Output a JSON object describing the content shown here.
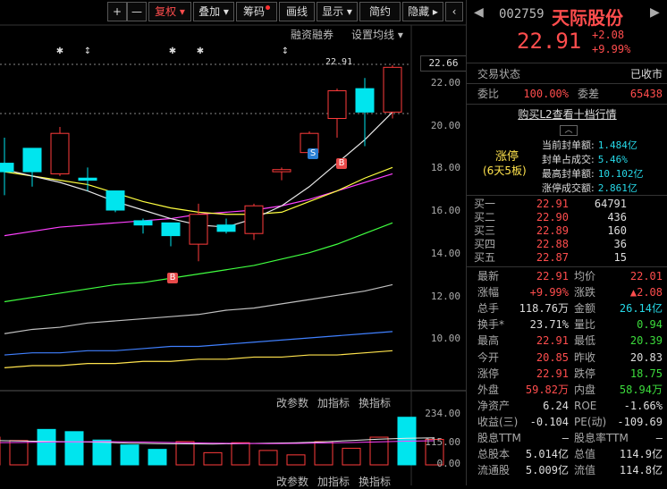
{
  "toolbar": {
    "plus": "+",
    "minus": "—",
    "fuquan": "复权",
    "diejia": "叠加",
    "chouma": "筹码",
    "huaxian": "画线",
    "xianshi": "显示",
    "jianyue": "简约",
    "yincang": "隐藏"
  },
  "chart_sub": {
    "rongzi": "融资融券",
    "shezhi": "设置均线"
  },
  "price_marker": "22.91",
  "current_price_tag": "22.66",
  "y_ticks": [
    "22.00",
    "20.00",
    "18.00",
    "16.00",
    "14.00",
    "12.00",
    "10.00"
  ],
  "signal_s": "S",
  "signal_b": "B",
  "indicator": {
    "gaicanshu": "改参数",
    "jiazhibiao": "加指标",
    "huanzhibiao": "换指标"
  },
  "vol_ticks": [
    "234.00",
    "115.00",
    "0.00"
  ],
  "chart_data": {
    "type": "candlestick",
    "ylim": [
      9,
      23
    ],
    "candles": [
      {
        "o": 18.2,
        "c": 17.8,
        "h": 19.4,
        "l": 16.7
      },
      {
        "o": 18.9,
        "c": 17.8,
        "h": 18.9,
        "l": 17.1
      },
      {
        "o": 17.7,
        "c": 19.6,
        "h": 19.9,
        "l": 17.6
      },
      {
        "o": 17.5,
        "c": 17.4,
        "h": 18.0,
        "l": 16.9
      },
      {
        "o": 16.9,
        "c": 16.0,
        "h": 16.9,
        "l": 15.9
      },
      {
        "o": 15.5,
        "c": 15.3,
        "h": 15.6,
        "l": 14.9
      },
      {
        "o": 15.4,
        "c": 14.8,
        "h": 15.3,
        "l": 14.3
      },
      {
        "o": 14.4,
        "c": 15.8,
        "h": 16.3,
        "l": 13.6
      },
      {
        "o": 15.3,
        "c": 15.0,
        "h": 15.6,
        "l": 14.9
      },
      {
        "o": 14.9,
        "c": 16.2,
        "h": 16.3,
        "l": 14.6
      },
      {
        "o": 17.8,
        "c": 17.9,
        "h": 18.0,
        "l": 17.4
      },
      {
        "o": 18.7,
        "c": 19.6,
        "h": 19.7,
        "l": 18.6
      },
      {
        "o": 20.3,
        "c": 21.6,
        "h": 21.7,
        "l": 19.4
      },
      {
        "o": 21.7,
        "c": 20.6,
        "h": 22.2,
        "l": 19.0
      },
      {
        "o": 20.6,
        "c": 22.7,
        "h": 22.8,
        "l": 20.3
      }
    ],
    "ma5": [
      17.9,
      17.6,
      17.3,
      16.9,
      16.4,
      16.0,
      15.6,
      15.3,
      15.2,
      15.6,
      16.2,
      17.1,
      18.2,
      19.3,
      20.6
    ],
    "ma10": [
      17.8,
      17.6,
      17.4,
      17.2,
      16.8,
      16.4,
      16.1,
      15.9,
      15.8,
      15.8,
      15.9,
      16.4,
      16.9,
      17.5,
      18.0
    ],
    "ma20": [
      14.8,
      15.0,
      15.2,
      15.3,
      15.4,
      15.5,
      15.6,
      15.8,
      15.9,
      16.0,
      16.2,
      16.5,
      16.9,
      17.3,
      17.7
    ],
    "ma30": [
      11.7,
      11.9,
      12.1,
      12.3,
      12.5,
      12.6,
      12.8,
      13.0,
      13.2,
      13.4,
      13.7,
      14.0,
      14.4,
      14.9,
      15.4
    ],
    "ma60": [
      10.2,
      10.4,
      10.5,
      10.7,
      10.8,
      10.9,
      11.0,
      11.1,
      11.3,
      11.4,
      11.6,
      11.8,
      12.0,
      12.2,
      12.5
    ],
    "ma120": [
      9.2,
      9.3,
      9.3,
      9.4,
      9.4,
      9.5,
      9.6,
      9.6,
      9.7,
      9.8,
      9.9,
      10.0,
      10.1,
      10.2,
      10.3
    ],
    "ma250": [
      8.6,
      8.7,
      8.7,
      8.8,
      8.8,
      8.9,
      8.9,
      9.0,
      9.0,
      9.1,
      9.1,
      9.2,
      9.2,
      9.3,
      9.4
    ],
    "volume": [
      125,
      110,
      160,
      150,
      112,
      90,
      70,
      105,
      55,
      100,
      65,
      45,
      105,
      75,
      125,
      215,
      115
    ],
    "volume_up": [
      false,
      false,
      true,
      true,
      true,
      true,
      true,
      false,
      false,
      false,
      false,
      false,
      false,
      false,
      false,
      true,
      false
    ],
    "vol_ylim": [
      0,
      234
    ]
  },
  "quote": {
    "code": "002759",
    "name": "天际股份",
    "price": "22.91",
    "change": "+2.08",
    "change_pct": "+9.99%",
    "trade_state_label": "交易状态",
    "trade_state_value": "已收市",
    "weibi_label": "委比",
    "weibi_value": "100.00%",
    "weicha_label": "委差",
    "weicha_value": "65438",
    "l2_link": "购买L2查看十档行情",
    "limit_title": "涨停",
    "limit_sub": "(6天5板)",
    "seal_labels": [
      "当前封单额:",
      "封单占成交:",
      "最高封单额:",
      "涨停成交额:"
    ],
    "seal_values": [
      "1.484亿",
      "5.46%",
      "10.102亿",
      "2.861亿"
    ]
  },
  "bids": [
    {
      "label": "买一",
      "price": "22.91",
      "vol": "64791"
    },
    {
      "label": "买二",
      "price": "22.90",
      "vol": "436"
    },
    {
      "label": "买三",
      "price": "22.89",
      "vol": "160"
    },
    {
      "label": "买四",
      "price": "22.88",
      "vol": "36"
    },
    {
      "label": "买五",
      "price": "22.87",
      "vol": "15"
    }
  ],
  "stats": [
    {
      "l1": "最新",
      "v1": "22.91",
      "c1": "r",
      "l2": "均价",
      "v2": "22.01",
      "c2": "r"
    },
    {
      "l1": "涨幅",
      "v1": "+9.99%",
      "c1": "r",
      "l2": "涨跌",
      "v2": "▲2.08",
      "c2": "r"
    },
    {
      "l1": "总手",
      "v1": "118.76万",
      "c1": "w",
      "l2": "金额",
      "v2": "26.14亿",
      "c2": "c"
    },
    {
      "l1": "换手*",
      "v1": "23.71%",
      "c1": "w",
      "l2": "量比",
      "v2": "0.94",
      "c2": "g"
    },
    {
      "l1": "最高",
      "v1": "22.91",
      "c1": "r",
      "l2": "最低",
      "v2": "20.39",
      "c2": "g"
    },
    {
      "l1": "今开",
      "v1": "20.85",
      "c1": "r",
      "l2": "昨收",
      "v2": "20.83",
      "c2": "w"
    },
    {
      "l1": "涨停",
      "v1": "22.91",
      "c1": "r",
      "l2": "跌停",
      "v2": "18.75",
      "c2": "g"
    },
    {
      "l1": "外盘",
      "v1": "59.82万",
      "c1": "r",
      "l2": "内盘",
      "v2": "58.94万",
      "c2": "g"
    },
    {
      "l1": "净资产",
      "v1": "6.24",
      "c1": "w",
      "l2": "ROE",
      "v2": "-1.66%",
      "c2": "w"
    },
    {
      "l1": "收益(三)",
      "v1": "-0.104",
      "c1": "w",
      "l2": "PE(动)",
      "v2": "-109.69",
      "c2": "w"
    },
    {
      "l1": "股息TTM",
      "v1": "—",
      "c1": "w",
      "l2": "股息率TTM",
      "v2": "—",
      "c2": "w"
    },
    {
      "l1": "总股本",
      "v1": "5.014亿",
      "c1": "w",
      "l2": "总值",
      "v2": "114.9亿",
      "c2": "w"
    },
    {
      "l1": "流通股",
      "v1": "5.009亿",
      "c1": "w",
      "l2": "流值",
      "v2": "114.8亿",
      "c2": "w"
    }
  ],
  "colors": {
    "up": "#ff3b3b",
    "down": "#00e5ee",
    "ma5": "#e8e8e8",
    "ma10": "#ffff40",
    "ma20": "#ff40ff",
    "ma30": "#40ff40",
    "ma60": "#c0c0c0",
    "ma120": "#4080ff",
    "ma250": "#ffe34d"
  }
}
